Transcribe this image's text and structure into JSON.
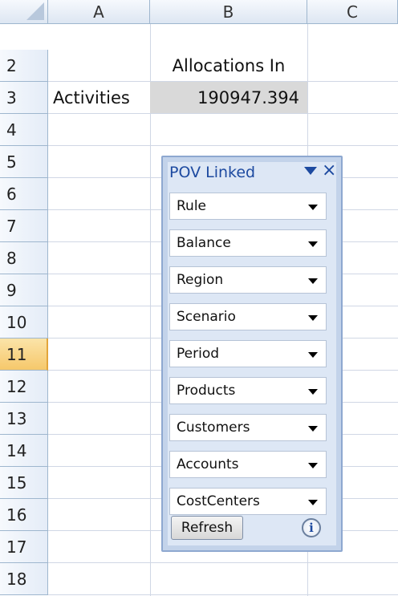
{
  "columns": [
    "A",
    "B",
    "C"
  ],
  "rows": [
    "2",
    "3",
    "4",
    "5",
    "6",
    "7",
    "8",
    "9",
    "10",
    "11",
    "12",
    "13",
    "14",
    "15",
    "16",
    "17",
    "18"
  ],
  "cells": {
    "b2": "Allocations In",
    "a3": "Activities",
    "b3": "190947.394"
  },
  "pov_panel": {
    "title": "POV Linked ",
    "close_glyph": "×",
    "dimensions": [
      "Rule",
      "Balance",
      "Region",
      "Scenario",
      "Period",
      "Products",
      "Customers",
      "Accounts",
      "CostCenters"
    ],
    "refresh_label": "Refresh",
    "info_glyph": "i"
  },
  "colors": {
    "header_bg": "#dde6f2",
    "active_row": "#f6c86b",
    "selected_cell": "#d9d9d9",
    "pov_border": "#8ea8d0",
    "pov_title": "#1d4aa0"
  }
}
